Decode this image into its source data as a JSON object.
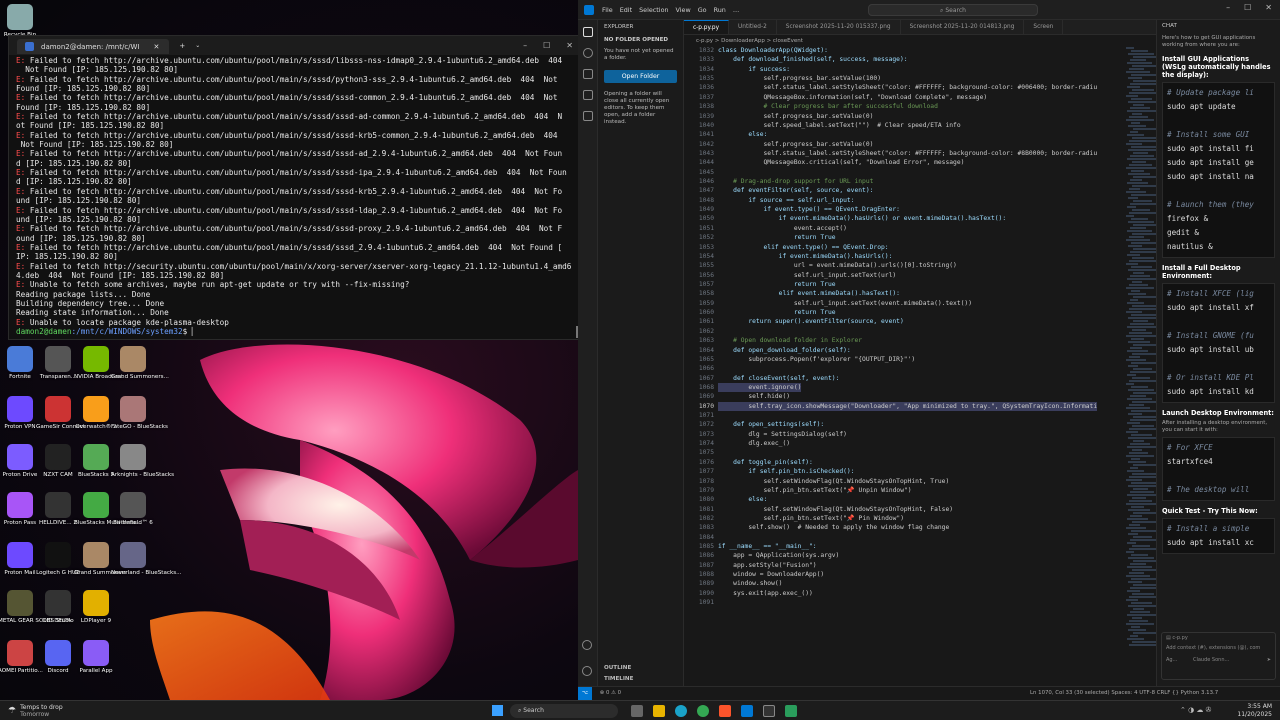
{
  "terminal": {
    "tab_title": "damon2@damen: /mnt/c/WI",
    "lines": [
      {
        "e": "E: ",
        "t": "Failed to fetch http://archive.ubuntu.com/ubuntu/pool/main/s/sssd/libsss-nss-idmap0_2.9.4-1ubuntu6.2_amd64.deb  404"
      },
      {
        "t": "  Not Found [IP: 185.125.190.82 80]"
      },
      {
        "e": "E: ",
        "t": "Failed to fetch http://archive.ubuntu.com/ubuntu/pool/main/s/sssd/python3-sss_2.9.4-1ubuntu6.2_amd64.deb  404  Not"
      },
      {
        "t": "Found [IP: 185.125.190.82 80]"
      },
      {
        "e": "E: ",
        "t": "Failed to fetch http://archive.ubuntu.com/ubuntu/pool/main/s/sssd/sssd-common_2.9.4-1ubuntu6.2_amd64.deb  404  Not"
      },
      {
        "t": "Found [IP: 185.125.190.82 80]"
      },
      {
        "e": "E: ",
        "t": "Failed to fetch http://archive.ubuntu.com/ubuntu/pool/main/s/sssd/sssd-ad-common_2.9.4-1ubuntu6.2_amd64.deb  404  N"
      },
      {
        "t": "ot Found [IP: 185.125.190.82 80]"
      },
      {
        "e": "E: ",
        "t": "Failed to fetch http://archive.ubuntu.com/ubuntu/pool/main/s/sssd/sssd-krb5-common_2.9.4-1ubuntu6.2_amd64.deb  404"
      },
      {
        "t": " Not Found [IP: 185.125.190.82 80]"
      },
      {
        "e": "E: ",
        "t": "Failed to fetch http://archive.ubuntu.com/ubuntu/pool/main/s/sssd/sssd-ad_2.9.4-1ubuntu6.2_amd64.deb  404  Not Foun"
      },
      {
        "t": "d [IP: 185.125.190.82 80]"
      },
      {
        "e": "E: ",
        "t": "Failed to fetch http://archive.ubuntu.com/ubuntu/pool/main/s/sssd/sssd-ipa_2.9.4-1ubuntu6.2_amd64.deb  404  Not Foun"
      },
      {
        "t": "d [IP: 185.125.190.82 80]"
      },
      {
        "e": "E: ",
        "t": "Failed to fetch http://archive.ubuntu.com/ubuntu/pool/main/s/sssd/sssd-krb5_2.9.4-1ubuntu6.2_amd64.deb  404  Not Fo"
      },
      {
        "t": "und [IP: 185.125.190.82 80]"
      },
      {
        "e": "E: ",
        "t": "Failed to fetch http://archive.ubuntu.com/ubuntu/pool/main/s/sssd/sssd-ldap_2.9.4-1ubuntu6.2_amd64.deb  404  Not Fo"
      },
      {
        "t": "und [IP: 185.125.190.82 80]"
      },
      {
        "e": "E: ",
        "t": "Failed to fetch http://archive.ubuntu.com/ubuntu/pool/main/s/sssd/sssd-proxy_2.9.4-1ubuntu6.2_amd64.deb  404  Not F"
      },
      {
        "t": "ound [IP: 185.125.190.82 80]"
      },
      {
        "e": "E: ",
        "t": "Failed to fetch http://archive.ubuntu.com/ubuntu/pool/main/s/sssd/sssd_2.9.4-1ubuntu6.2_amd64.deb  404  Not Found ["
      },
      {
        "t": "IP: 185.125.190.82 80]"
      },
      {
        "e": "E: ",
        "t": "Failed to fetch http://security.ubuntu.com/ubuntu/pool/main/x/xorg-server/xserver-xorg-legacy_21.1.12-1ubuntu1.4_amd6"
      },
      {
        "t": "4.deb  404  Not Found [IP: 185.125.190.82 80]"
      },
      {
        "e": "E: ",
        "t": "Unable to fetch some archives, maybe run apt-get update or try with --fix-missing?"
      },
      {
        "t": "Reading package lists... Done"
      },
      {
        "t": "Building dependency tree... Done"
      },
      {
        "t": "Reading state information... Done"
      },
      {
        "e": "E: ",
        "t": "Unable to locate package kde-plasma-desktop"
      }
    ],
    "prompt_user": "damon2@damen",
    "prompt_path": ":/mnt/c/WINDOWS/system32",
    "prompt_sym": "$ "
  },
  "desktop_icons": [
    {
      "label": "Recycle Bin",
      "color": "#8aa"
    },
    {
      "label": "Fortnite",
      "color": "#4a7bd8"
    },
    {
      "label": "Transparen...",
      "color": "#555"
    },
    {
      "label": "NVIDIA Broadcast",
      "color": "#76b900"
    },
    {
      "label": "Grand Summoners...",
      "color": "#a86"
    },
    {
      "label": "Proton VPN",
      "color": "#6d4aff"
    },
    {
      "label": "GameSir Connect",
      "color": "#c33"
    },
    {
      "label": "Overwatch® 2",
      "color": "#f99e1a"
    },
    {
      "label": "FateGO - BlueStacks",
      "color": "#a77"
    },
    {
      "label": "Proton Drive",
      "color": "#7c5cff"
    },
    {
      "label": "NZXT CAM",
      "color": "#222"
    },
    {
      "label": "BlueStacks 5",
      "color": "#5a5"
    },
    {
      "label": "Arknights - BlueStacks",
      "color": "#888"
    },
    {
      "label": "Proton Pass",
      "color": "#a855f7"
    },
    {
      "label": "HELLDIVE... 2",
      "color": "#333"
    },
    {
      "label": "BlueStacks Multi-Insta...",
      "color": "#4a4"
    },
    {
      "label": "Battlefield™ 6",
      "color": "#555"
    },
    {
      "label": "Proton Mail",
      "color": "#6d4aff"
    },
    {
      "label": "Logitech G HUB",
      "color": "#111"
    },
    {
      "label": "Grand Summoners",
      "color": "#a86"
    },
    {
      "label": "Neverland - BlueStacks...",
      "color": "#668"
    },
    {
      "label": "METAL GEAR SOLID DELTA",
      "color": "#553"
    },
    {
      "label": "OBS Studio",
      "color": "#333"
    },
    {
      "label": "LDPlayer 9",
      "color": "#e2b000"
    },
    {
      "label": "AOMEI Partitio...",
      "color": "#c44"
    },
    {
      "label": "Discord",
      "color": "#5865f2"
    },
    {
      "label": "Parallel App",
      "color": "#8a5cf6"
    }
  ],
  "vscode": {
    "menu": [
      "File",
      "Edit",
      "Selection",
      "View",
      "Go",
      "Run",
      "…"
    ],
    "search": "Search",
    "explorer_title": "EXPLORER",
    "no_folder": "NO FOLDER OPENED",
    "no_folder_msg": "You have not yet opened a folder.",
    "open_folder": "Open Folder",
    "folder_msg": "Opening a folder will close all currently open editors. To keep them open, add a folder instead.",
    "outline": "OUTLINE",
    "timeline": "TIMELINE",
    "tabs": [
      "c-p.py.py",
      "Untitled-2",
      "Screenshot 2025-11-20 015337.png",
      "Screenshot 2025-11-20 014813.png",
      "Screen"
    ],
    "breadcrumb": "c-p.py > DownloaderApp > closeEvent",
    "code_start": 1032,
    "code": [
      "class DownloaderApp(QWidget):",
      "    def download_finished(self, success, message):",
      "        if success:",
      "            self.progress_bar.setValue(100)",
      "            self.status_label.setStyleSheet(\"color: #FFFFFF; background-color: #006400; border-radiu",
      "            QMessageBox.information(self, \"Download Complete\", message)",
      "            # Clear progress bar after successful download",
      "            self.progress_bar.setValue(0)",
      "            self.speed_label.setText(\"\")  # Clear speed/ETA info",
      "        else:",
      "            self.progress_bar.setValue(0)",
      "            self.status_label.setStyleSheet(\"color: #FFFFFF; background-color: #8B0000; border-radiu",
      "            QMessageBox.critical(self, \"Download Error\", message)",
      "",
      "    # Drag-and-drop support for URL input",
      "    def eventFilter(self, source, event):",
      "        if source == self.url_input:",
      "            if event.type() == QEvent.DragEnter:",
      "                if event.mimeData().hasUrls() or event.mimeData().hasText():",
      "                    event.accept()",
      "                    return True",
      "            elif event.type() == QEvent.Drop:",
      "                if event.mimeData().hasUrls():",
      "                    url = event.mimeData().urls()[0].toString()",
      "                    self.url_input.setText(url)",
      "                    return True",
      "                elif event.mimeData().hasText():",
      "                    self.url_input.setText(event.mimeData().text())",
      "                    return True",
      "        return super().eventFilter(source, event)",
      "",
      "    # Open download folder in Explorer",
      "    def open_download_folder(self):",
      "        subprocess.Popen(f'explorer \"{OUTPUT_DIR}\"')",
      "",
      "    def closeEvent(self, event):",
      "        event.ignore()",
      "        self.hide()",
      "        self.tray_icon.showMessage(\"Downloader\", \"App minimized to tray.\", QSystemTrayIcon.Informati",
      "",
      "    def open_settings(self):",
      "        dlg = SettingsDialog(self)",
      "        dlg.exec_()",
      "",
      "    def toggle_pin(self):",
      "        if self.pin_btn.isChecked():",
      "            self.setWindowFlag(Qt.WindowStaysOnTopHint, True)",
      "            self.pin_btn.setText(\"📌 Unpin Window\")",
      "        else:",
      "            self.setWindowFlag(Qt.WindowStaysOnTopHint, False)",
      "            self.pin_btn.setText(\"📌 Pin Window\")",
      "        self.show()  # Needed to apply the window flag change",
      "",
      "if __name__ == \"__main__\":",
      "    app = QApplication(sys.argv)",
      "    app.setStyle(\"Fusion\")",
      "    window = DownloaderApp()",
      "    window.show()",
      "    sys.exit(app.exec_())",
      ""
    ],
    "status_left": "⊗ 0 ⚠ 0",
    "status_right": "Ln 1070, Col 33 (30 selected)   Spaces: 4   UTF-8   CRLF   {} Python   3.13.7"
  },
  "chat": {
    "title": "CHAT",
    "intro": "Here's how to get GUI applications working from where you are:",
    "h1": "Install GUI Applications (WSLg automatically handles the display):",
    "code1": [
      "# Update package li",
      "sudo apt update",
      "",
      "# Install some GUI",
      "sudo apt install fi",
      "sudo apt install ge",
      "sudo apt install na",
      "",
      "# Launch them (they",
      "firefox &",
      "gedit &",
      "nautilus &"
    ],
    "h2": "Install a Full Desktop Environment:",
    "code2": [
      "# Install XFCE (lig",
      "sudo apt install xf",
      "",
      "# Install GNOME (fu",
      "sudo apt install ub",
      "",
      "# Or install KDE Pl",
      "sudo apt install kd"
    ],
    "h3": "Launch Desktop Environment:",
    "p3": "After installing a desktop environment, you can start it with:",
    "code3": [
      "# For XFCE",
      "startxfce4",
      "",
      "# The desktop will"
    ],
    "h4": "Quick Test - Try This Now:",
    "code4": [
      "# Install a simple",
      "sudo apt install xc"
    ],
    "attach": "c-p.py",
    "input_placeholder": "Add context (#), extensions (@), com",
    "agent": "Ag...",
    "model": "Claude Sonn..."
  },
  "taskbar": {
    "weather": "Temps to drop",
    "weather2": "Tomorrow",
    "search": "Search",
    "time": "3:55 AM",
    "date": "11/20/2025"
  }
}
